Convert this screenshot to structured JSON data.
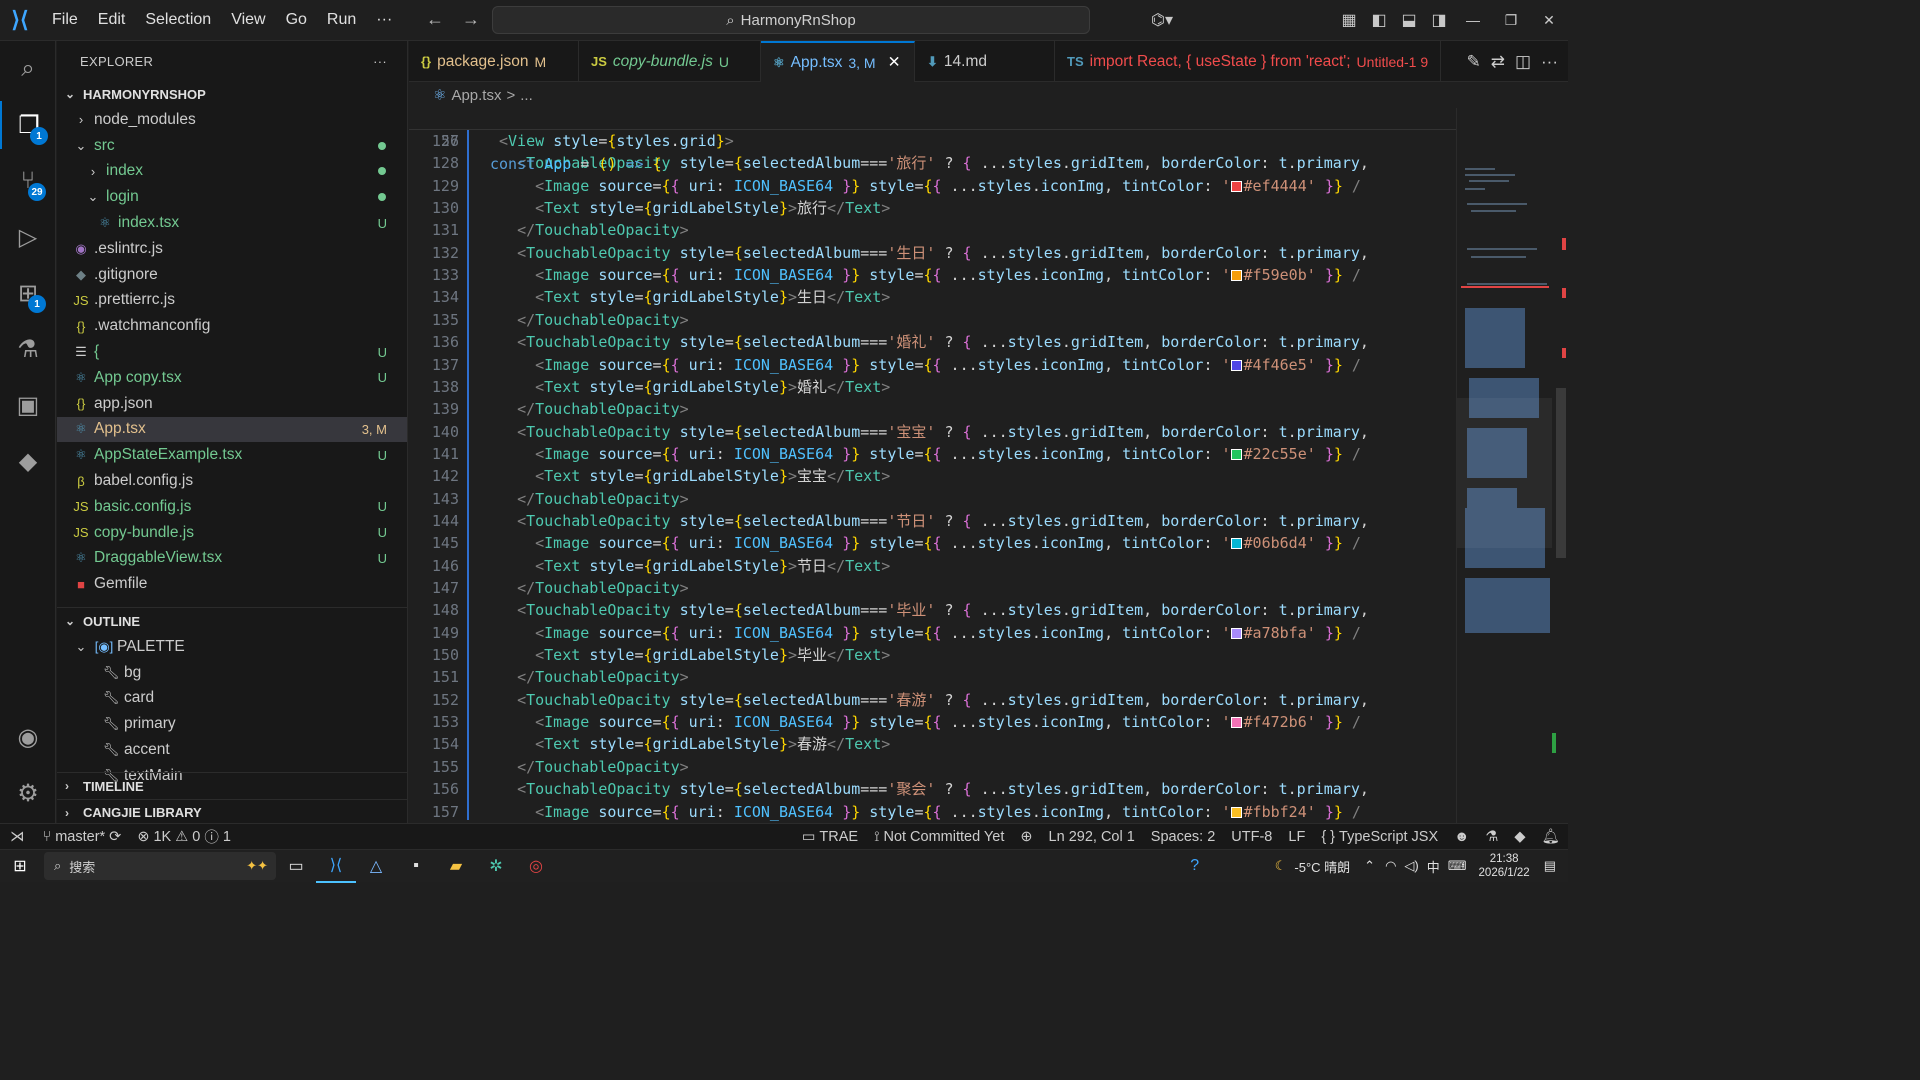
{
  "titlebar": {
    "menu": [
      "File",
      "Edit",
      "Selection",
      "View",
      "Go",
      "Run",
      "···"
    ],
    "search": "HarmonyRnShop"
  },
  "activity": {
    "explorer_badge": "1",
    "scm_badge": "29",
    "extensions_badge": "1"
  },
  "explorer": {
    "title": "EXPLORER",
    "more": "···",
    "root": "HARMONYRNSHOP",
    "items": [
      {
        "label": "node_modules",
        "status": ""
      },
      {
        "label": "src",
        "status": ""
      },
      {
        "label": "index",
        "status": ""
      },
      {
        "label": "login",
        "status": ""
      },
      {
        "label": "index.tsx",
        "status": "U"
      },
      {
        "label": ".eslintrc.js",
        "status": ""
      },
      {
        "label": ".gitignore",
        "status": ""
      },
      {
        "label": ".prettierrc.js",
        "status": ""
      },
      {
        "label": ".watchmanconfig",
        "status": ""
      },
      {
        "label": "{",
        "status": "U"
      },
      {
        "label": "App copy.tsx",
        "status": "U"
      },
      {
        "label": "app.json",
        "status": ""
      },
      {
        "label": "App.tsx",
        "status": "3, M"
      },
      {
        "label": "AppStateExample.tsx",
        "status": "U"
      },
      {
        "label": "babel.config.js",
        "status": ""
      },
      {
        "label": "basic.config.js",
        "status": "U"
      },
      {
        "label": "copy-bundle.js",
        "status": "U"
      },
      {
        "label": "DraggableView.tsx",
        "status": "U"
      },
      {
        "label": "Gemfile",
        "status": ""
      }
    ]
  },
  "outline": {
    "title": "OUTLINE",
    "root": "PALETTE",
    "items": [
      "bg",
      "card",
      "primary",
      "accent",
      "textMain"
    ]
  },
  "timeline": "TIMELINE",
  "cangjie": "CANGJIE LIBRARY",
  "tabs": [
    {
      "icon": "{}",
      "label": "package.json",
      "status": "M"
    },
    {
      "icon": "JS",
      "label": "copy-bundle.js",
      "status": "U"
    },
    {
      "icon": "⚛",
      "label": "App.tsx",
      "status": "3, M"
    },
    {
      "icon": "⬇",
      "label": "14.md",
      "status": ""
    },
    {
      "icon": "TS",
      "label": "import React, { useState } from 'react';",
      "status": "Untitled-1 9"
    }
  ],
  "breadcrumb": [
    "App.tsx",
    ">",
    "..."
  ],
  "sticky": {
    "num": "56",
    "code": "const App = () => {"
  },
  "code_lines": [
    {
      "n": "127",
      "tag": "View",
      "kind": "view"
    },
    {
      "n": "128",
      "label": "旅行",
      "kind": "open"
    },
    {
      "n": "129",
      "color": "#ef4444",
      "kind": "image"
    },
    {
      "n": "130",
      "label": "旅行",
      "kind": "text"
    },
    {
      "n": "131",
      "kind": "close"
    },
    {
      "n": "132",
      "label": "生日",
      "kind": "open"
    },
    {
      "n": "133",
      "color": "#f59e0b",
      "kind": "image"
    },
    {
      "n": "134",
      "label": "生日",
      "kind": "text"
    },
    {
      "n": "135",
      "kind": "close"
    },
    {
      "n": "136",
      "label": "婚礼",
      "kind": "open"
    },
    {
      "n": "137",
      "color": "#4f46e5",
      "kind": "image"
    },
    {
      "n": "138",
      "label": "婚礼",
      "kind": "text"
    },
    {
      "n": "139",
      "kind": "close"
    },
    {
      "n": "140",
      "label": "宝宝",
      "kind": "open"
    },
    {
      "n": "141",
      "color": "#22c55e",
      "kind": "image"
    },
    {
      "n": "142",
      "label": "宝宝",
      "kind": "text"
    },
    {
      "n": "143",
      "kind": "close"
    },
    {
      "n": "144",
      "label": "节日",
      "kind": "open"
    },
    {
      "n": "145",
      "color": "#06b6d4",
      "kind": "image"
    },
    {
      "n": "146",
      "label": "节日",
      "kind": "text"
    },
    {
      "n": "147",
      "kind": "close"
    },
    {
      "n": "148",
      "label": "毕业",
      "kind": "open"
    },
    {
      "n": "149",
      "color": "#a78bfa",
      "kind": "image"
    },
    {
      "n": "150",
      "label": "毕业",
      "kind": "text"
    },
    {
      "n": "151",
      "kind": "close"
    },
    {
      "n": "152",
      "label": "春游",
      "kind": "open"
    },
    {
      "n": "153",
      "color": "#f472b6",
      "kind": "image"
    },
    {
      "n": "154",
      "label": "春游",
      "kind": "text"
    },
    {
      "n": "155",
      "kind": "close"
    },
    {
      "n": "156",
      "label": "聚会",
      "kind": "open"
    },
    {
      "n": "157",
      "color": "#fbbf24",
      "kind": "image"
    }
  ],
  "status": {
    "branch": "master*",
    "errors": "1K",
    "warnings": "0",
    "infos": "1",
    "trae": "TRAE",
    "commit": "Not Committed Yet",
    "position": "Ln 292, Col 1",
    "spaces": "Spaces: 2",
    "encoding": "UTF-8",
    "eol": "LF",
    "language": "TypeScript JSX"
  },
  "taskbar": {
    "search": "搜索",
    "weather": "-5°C 晴朗",
    "ime": "中",
    "time": "21:38",
    "date": "2026/1/22"
  }
}
